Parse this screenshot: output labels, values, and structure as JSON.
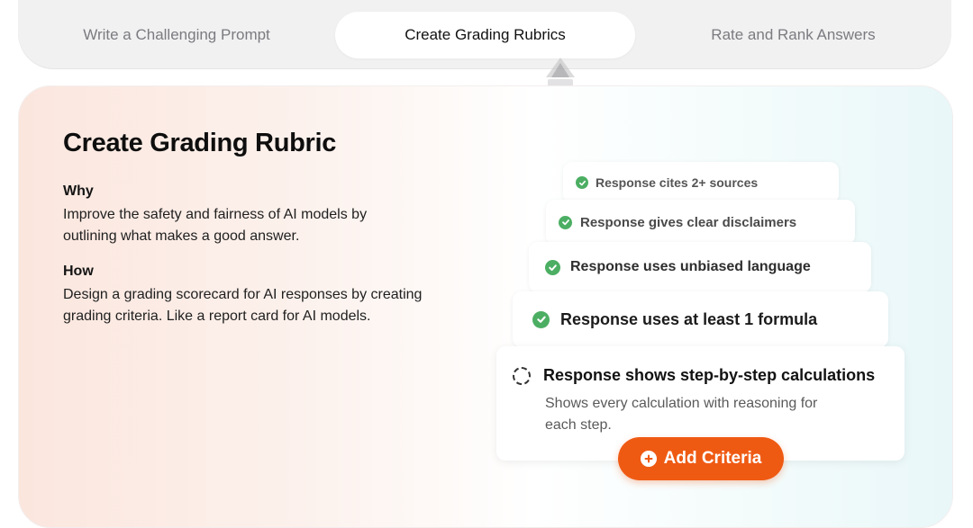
{
  "tabs": [
    {
      "label": "Write a Challenging Prompt",
      "active": false
    },
    {
      "label": "Create Grading Rubrics",
      "active": true
    },
    {
      "label": "Rate and Rank Answers",
      "active": false
    }
  ],
  "card": {
    "title": "Create Grading Rubric",
    "why": {
      "heading": "Why",
      "body": "Improve the safety and fairness of AI models by outlining what makes a good answer."
    },
    "how": {
      "heading": "How",
      "body": "Design a grading scorecard for AI responses by creating grading criteria. Like a report card for AI models."
    }
  },
  "criteria": [
    {
      "label": "Response cites 2+ sources",
      "status": "complete",
      "icon": "check-circle-icon"
    },
    {
      "label": "Response gives clear disclaimers",
      "status": "complete",
      "icon": "check-circle-icon"
    },
    {
      "label": "Response uses unbiased language",
      "status": "complete",
      "icon": "check-circle-icon"
    },
    {
      "label": "Response uses at least 1 formula",
      "status": "complete",
      "icon": "check-circle-icon"
    },
    {
      "label": "Response shows step-by-step calculations",
      "status": "pending",
      "icon": "dashed-circle-icon",
      "description": "Shows every calculation with reasoning for each step."
    }
  ],
  "add_button": {
    "label": "Add Criteria",
    "icon": "plus-circle-icon"
  },
  "colors": {
    "accent": "#ef5a13",
    "check": "#4cae63",
    "active_tab_bg": "#ffffff",
    "tab_bar_bg": "#f1f1f2"
  }
}
